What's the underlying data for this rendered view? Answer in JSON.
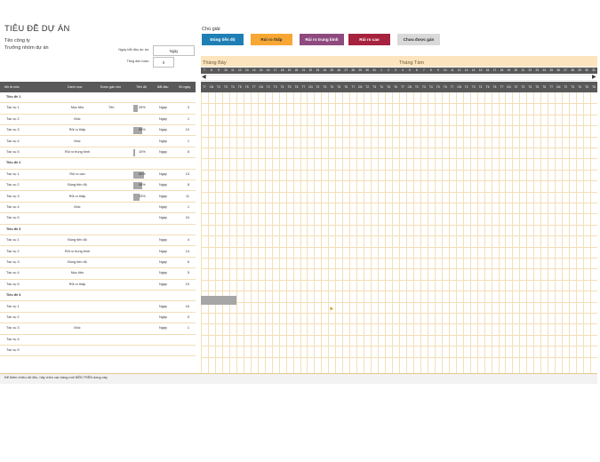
{
  "header": {
    "title": "TIÊU ĐỀ DỰ ÁN",
    "company": "Tên công ty",
    "manager": "Trưởng nhóm dự án"
  },
  "params": {
    "start_label": "Ngày bắt đầu dự án:",
    "start_value": "Ngày",
    "week_label": "Tăng dần tuần:",
    "week_value": "0"
  },
  "legend": {
    "label": "Chú giải:",
    "items": [
      {
        "label": "Đúng tiến độ",
        "bg": "#1f7fb5",
        "fg": "#ffffff"
      },
      {
        "label": "Rủi ro thấp",
        "bg": "#f7a733",
        "fg": "#333333"
      },
      {
        "label": "Rủi ro trung bình",
        "bg": "#8e4a7f",
        "fg": "#ffffff"
      },
      {
        "label": "Rủi ro cao",
        "bg": "#a6223f",
        "fg": "#ffffff"
      },
      {
        "label": "Chưa được gán",
        "bg": "#d9d9d9",
        "fg": "#333333"
      }
    ]
  },
  "months": [
    "Tháng Bảy",
    "Tháng Tám"
  ],
  "dates": [
    "7",
    "8",
    "9",
    "10",
    "11",
    "12",
    "13",
    "14",
    "15",
    "16",
    "17",
    "18",
    "19",
    "20",
    "21",
    "22",
    "23",
    "24",
    "25",
    "26",
    "27",
    "28",
    "29",
    "30",
    "31",
    "1",
    "2",
    "3",
    "4",
    "5",
    "6",
    "7",
    "8",
    "9",
    "10",
    "11",
    "12",
    "13",
    "14",
    "15",
    "16",
    "17",
    "18",
    "19",
    "20",
    "21",
    "22",
    "23",
    "24",
    "25",
    "26",
    "27",
    "28",
    "29",
    "30",
    "31"
  ],
  "weekdays": [
    "T7",
    "CN",
    "T2",
    "T3",
    "T4",
    "T5",
    "T6",
    "T7",
    "CN",
    "T2",
    "T3",
    "T4",
    "T5",
    "T6",
    "T7",
    "CN",
    "T2",
    "T3",
    "T4",
    "T5",
    "T6",
    "T7",
    "CN",
    "T2",
    "T3",
    "T4",
    "T5",
    "T6",
    "T7",
    "CN",
    "T2",
    "T3",
    "T4",
    "T5",
    "T6",
    "T7",
    "CN",
    "T2",
    "T3",
    "T4",
    "T5",
    "T6",
    "T7",
    "CN",
    "T2",
    "T3",
    "T4",
    "T5",
    "T6",
    "T7",
    "CN",
    "T2",
    "T3",
    "T4",
    "T5",
    "T6"
  ],
  "columns": [
    "Mô tả mốc",
    "Danh mục",
    "Được gán cho",
    "Tiến độ",
    "Bắt đầu",
    "Số ngày"
  ],
  "rows": [
    {
      "type": "heading",
      "desc": "Tiêu đề 1"
    },
    {
      "type": "task",
      "desc": "Tác vụ 1",
      "cat": "Mục tiêu",
      "assign": "Tên",
      "pct": "25%",
      "progress": 0.25,
      "start": "Ngày",
      "days": "3"
    },
    {
      "type": "task",
      "desc": "Tác vụ 2",
      "cat": "Mốc",
      "assign": "",
      "pct": "",
      "progress": 0,
      "start": "Ngày",
      "days": "1"
    },
    {
      "type": "task",
      "desc": "Tác vụ 3",
      "cat": "Rủi ro thấp",
      "assign": "",
      "pct": "50%",
      "progress": 0.5,
      "start": "Ngày",
      "days": "10"
    },
    {
      "type": "task",
      "desc": "Tác vụ 4",
      "cat": "Mốc",
      "assign": "",
      "pct": "",
      "progress": 0,
      "start": "Ngày",
      "days": "1"
    },
    {
      "type": "task",
      "desc": "Tác vụ 5",
      "cat": "Rủi ro trung bình",
      "assign": "",
      "pct": "10%",
      "progress": 0.1,
      "start": "Ngày",
      "days": "6"
    },
    {
      "type": "heading",
      "desc": "Tiêu đề 2"
    },
    {
      "type": "task",
      "desc": "Tác vụ 1",
      "cat": "Rủi ro cao",
      "assign": "",
      "pct": "60%",
      "progress": 0.6,
      "start": "Ngày",
      "days": "13"
    },
    {
      "type": "task",
      "desc": "Tác vụ 2",
      "cat": "Đúng tiến độ",
      "assign": "",
      "pct": "50%",
      "progress": 0.5,
      "start": "Ngày",
      "days": "8"
    },
    {
      "type": "task",
      "desc": "Tác vụ 3",
      "cat": "Rủi ro thấp",
      "assign": "",
      "pct": "33%",
      "progress": 0.33,
      "start": "Ngày",
      "days": "11"
    },
    {
      "type": "task",
      "desc": "Tác vụ 4",
      "cat": "Mốc",
      "assign": "",
      "pct": "",
      "progress": 0,
      "start": "Ngày",
      "days": "1"
    },
    {
      "type": "task",
      "desc": "Tác vụ 5",
      "cat": "",
      "assign": "",
      "pct": "",
      "progress": 0,
      "start": "Ngày",
      "days": "24"
    },
    {
      "type": "heading",
      "desc": "Tiêu đề 3"
    },
    {
      "type": "task",
      "desc": "Tác vụ 1",
      "cat": "Đúng tiến độ",
      "assign": "",
      "pct": "",
      "progress": 0,
      "start": "Ngày",
      "days": "4"
    },
    {
      "type": "task",
      "desc": "Tác vụ 2",
      "cat": "Rủi ro trung bình",
      "assign": "",
      "pct": "",
      "progress": 0,
      "start": "Ngày",
      "days": "14"
    },
    {
      "type": "task",
      "desc": "Tác vụ 3",
      "cat": "Đúng tiến độ",
      "assign": "",
      "pct": "",
      "progress": 0,
      "start": "Ngày",
      "days": "6"
    },
    {
      "type": "task",
      "desc": "Tác vụ 4",
      "cat": "Mục tiêu",
      "assign": "",
      "pct": "",
      "progress": 0,
      "start": "Ngày",
      "days": "5"
    },
    {
      "type": "task",
      "desc": "Tác vụ 5",
      "cat": "Rủi ro thấp",
      "assign": "",
      "pct": "",
      "progress": 0,
      "start": "Ngày",
      "days": "19"
    },
    {
      "type": "heading",
      "desc": "Tiêu đề 4"
    },
    {
      "type": "task",
      "desc": "Tác vụ 1",
      "cat": "",
      "assign": "",
      "pct": "",
      "progress": 0,
      "start": "Ngày",
      "days": "16"
    },
    {
      "type": "task",
      "desc": "Tác vụ 2",
      "cat": "",
      "assign": "",
      "pct": "",
      "progress": 0,
      "start": "Ngày",
      "days": "5"
    },
    {
      "type": "task",
      "desc": "Tác vụ 3",
      "cat": "Mốc",
      "assign": "",
      "pct": "",
      "progress": 0,
      "start": "Ngày",
      "days": "1"
    },
    {
      "type": "task",
      "desc": "Tác vụ 4",
      "cat": "",
      "assign": "",
      "pct": "",
      "progress": 0,
      "start": "",
      "days": ""
    },
    {
      "type": "task",
      "desc": "Tác vụ 5",
      "cat": "",
      "assign": "",
      "pct": "",
      "progress": 0,
      "start": "",
      "days": ""
    }
  ],
  "footer": "Để thêm nhiều dữ liệu, hãy chèn các hàng mới BÊN TRÊN dòng này"
}
